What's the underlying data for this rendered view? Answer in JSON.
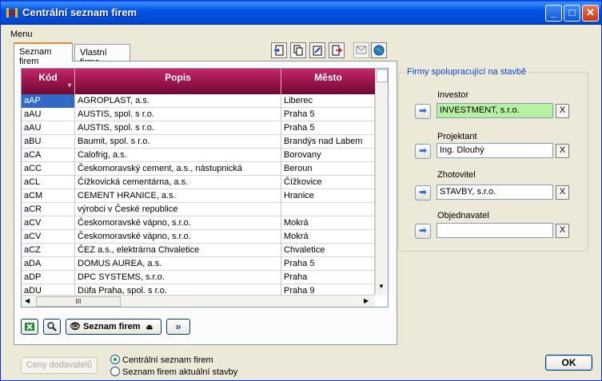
{
  "window": {
    "title": "Centrální seznam firem"
  },
  "titlebar_buttons": {
    "minimize": "_",
    "maximize": "□",
    "close": "✕"
  },
  "menu": {
    "label": "Menu"
  },
  "tabs": [
    {
      "label": "Seznam firem"
    },
    {
      "label": "Vlastní firma"
    }
  ],
  "grid": {
    "columns": [
      {
        "label": "Kód"
      },
      {
        "label": "Popis"
      },
      {
        "label": "Město"
      }
    ],
    "rows": [
      {
        "kod": "aAP",
        "popis": "AGROPLAST, a.s.",
        "mesto": "Liberec"
      },
      {
        "kod": "aAU",
        "popis": "AUSTIS, spol. s r.o.",
        "mesto": "Praha 5"
      },
      {
        "kod": "aAU",
        "popis": "AUSTIS, spol. s r.o.",
        "mesto": "Praha 5"
      },
      {
        "kod": "aBU",
        "popis": "Baumit, spol. s r.o.",
        "mesto": "Brandýs nad Labem"
      },
      {
        "kod": "aCA",
        "popis": "Calofrig, a.s.",
        "mesto": "Borovany"
      },
      {
        "kod": "aCC",
        "popis": "Českomoravský cement, a.s., nástupnická",
        "mesto": "Beroun"
      },
      {
        "kod": "aCL",
        "popis": "Čížkovická cementárna, a.s.",
        "mesto": "Čížkovice"
      },
      {
        "kod": "aCM",
        "popis": "CEMENT HRANICE, a.s.",
        "mesto": "Hranice"
      },
      {
        "kod": "aCR",
        "popis": "výrobci v České republice",
        "mesto": ""
      },
      {
        "kod": "aCV",
        "popis": "Českomoravské vápno, s.r.o.",
        "mesto": "Mokrá"
      },
      {
        "kod": "aCV",
        "popis": "Českomoravské vápno, s.r.o.",
        "mesto": "Mokrá"
      },
      {
        "kod": "aCZ",
        "popis": "ČEZ a.s., elektrárna Chvaletice",
        "mesto": "Chvaletice"
      },
      {
        "kod": "aDA",
        "popis": "DOMUS AUREA, a.s.",
        "mesto": "Praha 5"
      },
      {
        "kod": "aDP",
        "popis": "DPC SYSTEMS, s.r.o.",
        "mesto": "Praha"
      },
      {
        "kod": "aDU",
        "popis": "Dúfa Praha, spol. s r.o.",
        "mesto": "Praha 9"
      }
    ],
    "selected_row": 0,
    "scroll_thumb": "III"
  },
  "bottom_toolbar": {
    "view_label": "Seznam firem",
    "next_label": "»"
  },
  "partners": {
    "legend": "Firmy spolupracující na stavbě",
    "roles": [
      {
        "label": "Investor",
        "value": "INVESTMENT, s.r.o."
      },
      {
        "label": "Projektant",
        "value": "Ing. Dlouhý"
      },
      {
        "label": "Zhotovitel",
        "value": "STAVBY, s.r.o."
      },
      {
        "label": "Objednavatel",
        "value": ""
      }
    ],
    "clear_label": "X",
    "arrow_label": "➡"
  },
  "footer": {
    "ceny_label": "Ceny dodavatelů",
    "radio_options": [
      {
        "label": "Centrální seznam firem",
        "checked": true
      },
      {
        "label": "Seznam firem aktuální stavby",
        "checked": false
      }
    ],
    "ok_label": "OK"
  }
}
